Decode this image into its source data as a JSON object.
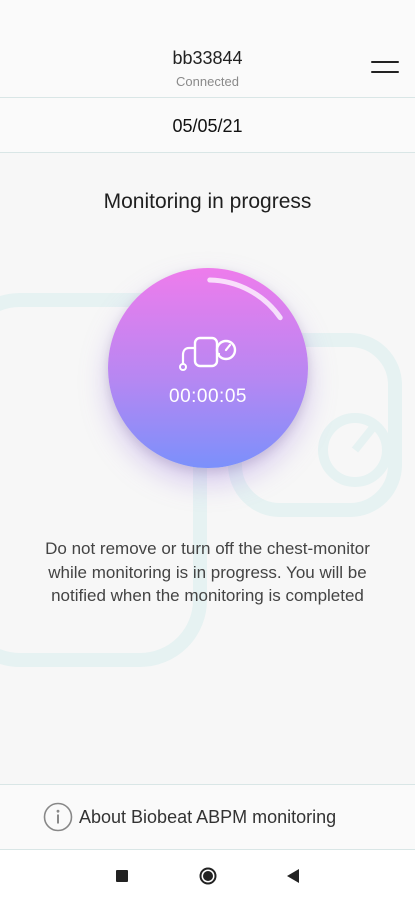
{
  "header": {
    "device_name": "bb33844",
    "device_status": "Connected",
    "menu_icon": "hamburger-menu-icon"
  },
  "date_bar": {
    "date": "05/05/21"
  },
  "monitoring": {
    "title": "Monitoring in progress",
    "timer": "00:00:05",
    "progress_fraction": 0.1,
    "notice": "Do not remove or turn off the chest-monitor while monitoring is in progress. You will be notified when the monitoring is completed",
    "icon": "blood-pressure-monitor-icon",
    "colors": {
      "gradient_top": "#ee7cec",
      "gradient_bottom": "#7b90fb"
    }
  },
  "about": {
    "label": "About Biobeat ABPM monitoring",
    "icon": "info-icon"
  },
  "nav": {
    "recents_icon": "square-recents-icon",
    "home_icon": "circle-home-icon",
    "back_icon": "triangle-back-icon"
  }
}
